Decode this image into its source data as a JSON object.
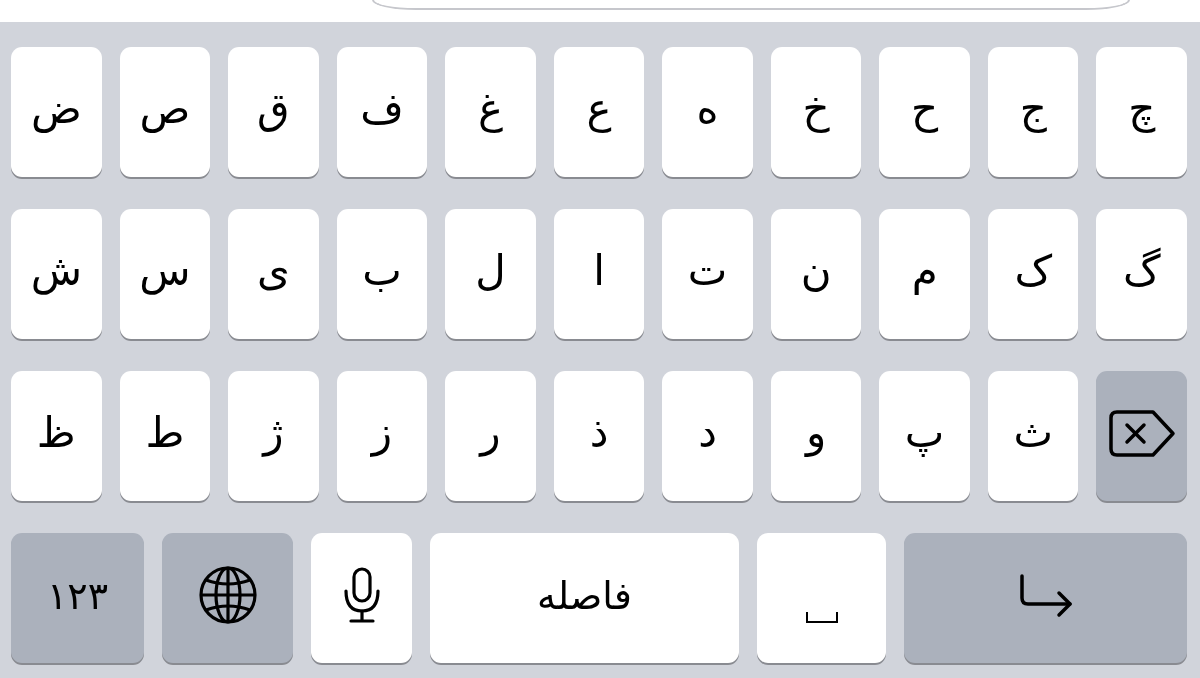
{
  "keyboard": {
    "rows": [
      {
        "keys": [
          {
            "kind": "letter",
            "label": "چ"
          },
          {
            "kind": "letter",
            "label": "ج"
          },
          {
            "kind": "letter",
            "label": "ح"
          },
          {
            "kind": "letter",
            "label": "خ"
          },
          {
            "kind": "letter",
            "label": "ه"
          },
          {
            "kind": "letter",
            "label": "ع"
          },
          {
            "kind": "letter",
            "label": "غ"
          },
          {
            "kind": "letter",
            "label": "ف"
          },
          {
            "kind": "letter",
            "label": "ق"
          },
          {
            "kind": "letter",
            "label": "ص"
          },
          {
            "kind": "letter",
            "label": "ض"
          }
        ]
      },
      {
        "keys": [
          {
            "kind": "letter",
            "label": "گ"
          },
          {
            "kind": "letter",
            "label": "ک"
          },
          {
            "kind": "letter",
            "label": "م"
          },
          {
            "kind": "letter",
            "label": "ن"
          },
          {
            "kind": "letter",
            "label": "ت"
          },
          {
            "kind": "letter",
            "label": "ا"
          },
          {
            "kind": "letter",
            "label": "ل"
          },
          {
            "kind": "letter",
            "label": "ب"
          },
          {
            "kind": "letter",
            "label": "ی"
          },
          {
            "kind": "letter",
            "label": "س"
          },
          {
            "kind": "letter",
            "label": "ش"
          }
        ]
      },
      {
        "keys": [
          {
            "kind": "delete"
          },
          {
            "kind": "letter",
            "label": "ث"
          },
          {
            "kind": "letter",
            "label": "پ"
          },
          {
            "kind": "letter",
            "label": "و"
          },
          {
            "kind": "letter",
            "label": "د"
          },
          {
            "kind": "letter",
            "label": "ذ"
          },
          {
            "kind": "letter",
            "label": "ر"
          },
          {
            "kind": "letter",
            "label": "ز"
          },
          {
            "kind": "letter",
            "label": "ژ"
          },
          {
            "kind": "letter",
            "label": "ط"
          },
          {
            "kind": "letter",
            "label": "ظ"
          }
        ]
      },
      {
        "keys": [
          {
            "kind": "return"
          },
          {
            "kind": "zwnj"
          },
          {
            "kind": "space",
            "label": "فاصله"
          },
          {
            "kind": "mic"
          },
          {
            "kind": "globe"
          },
          {
            "kind": "numbers",
            "label": "۱۲۳"
          }
        ]
      }
    ]
  }
}
